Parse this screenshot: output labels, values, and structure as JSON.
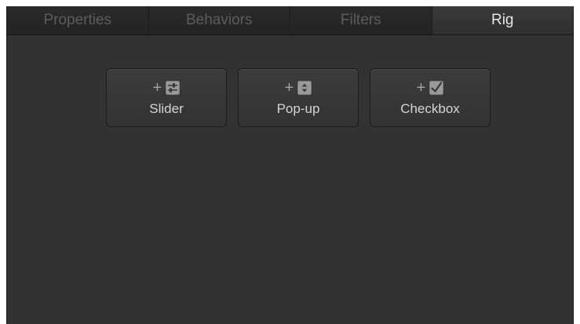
{
  "tabs": [
    {
      "label": "Properties",
      "active": false
    },
    {
      "label": "Behaviors",
      "active": false
    },
    {
      "label": "Filters",
      "active": false
    },
    {
      "label": "Rig",
      "active": true
    }
  ],
  "add_buttons": [
    {
      "plus": "+",
      "icon": "slider-icon",
      "label": "Slider"
    },
    {
      "plus": "+",
      "icon": "popup-icon",
      "label": "Pop-up"
    },
    {
      "plus": "+",
      "icon": "checkbox-icon",
      "label": "Checkbox"
    }
  ],
  "colors": {
    "panel_bg": "#323232",
    "tab_active_text": "#e6e6e6",
    "tab_inactive_text": "#5c5c5c",
    "button_text": "#d4d4d4"
  }
}
